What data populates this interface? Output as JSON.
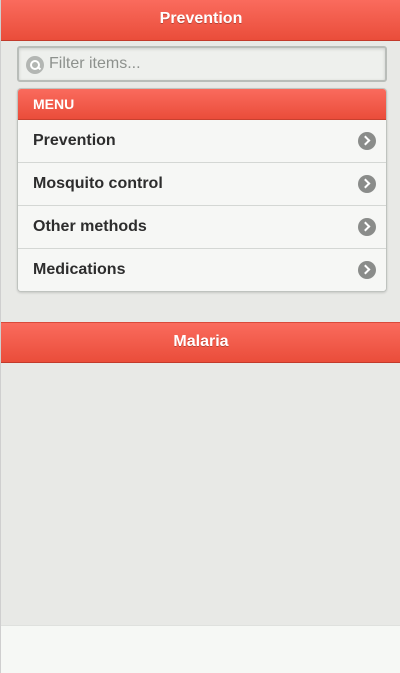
{
  "header": {
    "title": "Prevention"
  },
  "search": {
    "placeholder": "Filter items...",
    "icon": "search-icon"
  },
  "menu": {
    "divider": "MENU",
    "items": [
      {
        "label": "Prevention",
        "icon": "chevron-right-icon"
      },
      {
        "label": "Mosquito control",
        "icon": "chevron-right-icon"
      },
      {
        "label": "Other methods",
        "icon": "chevron-right-icon"
      },
      {
        "label": "Medications",
        "icon": "chevron-right-icon"
      }
    ]
  },
  "section_header": {
    "title": "Malaria"
  },
  "colors": {
    "accent": "#ef5a48",
    "background": "#e8e9e6",
    "list_background": "#f6f7f5",
    "text": "#2d2d2d"
  }
}
